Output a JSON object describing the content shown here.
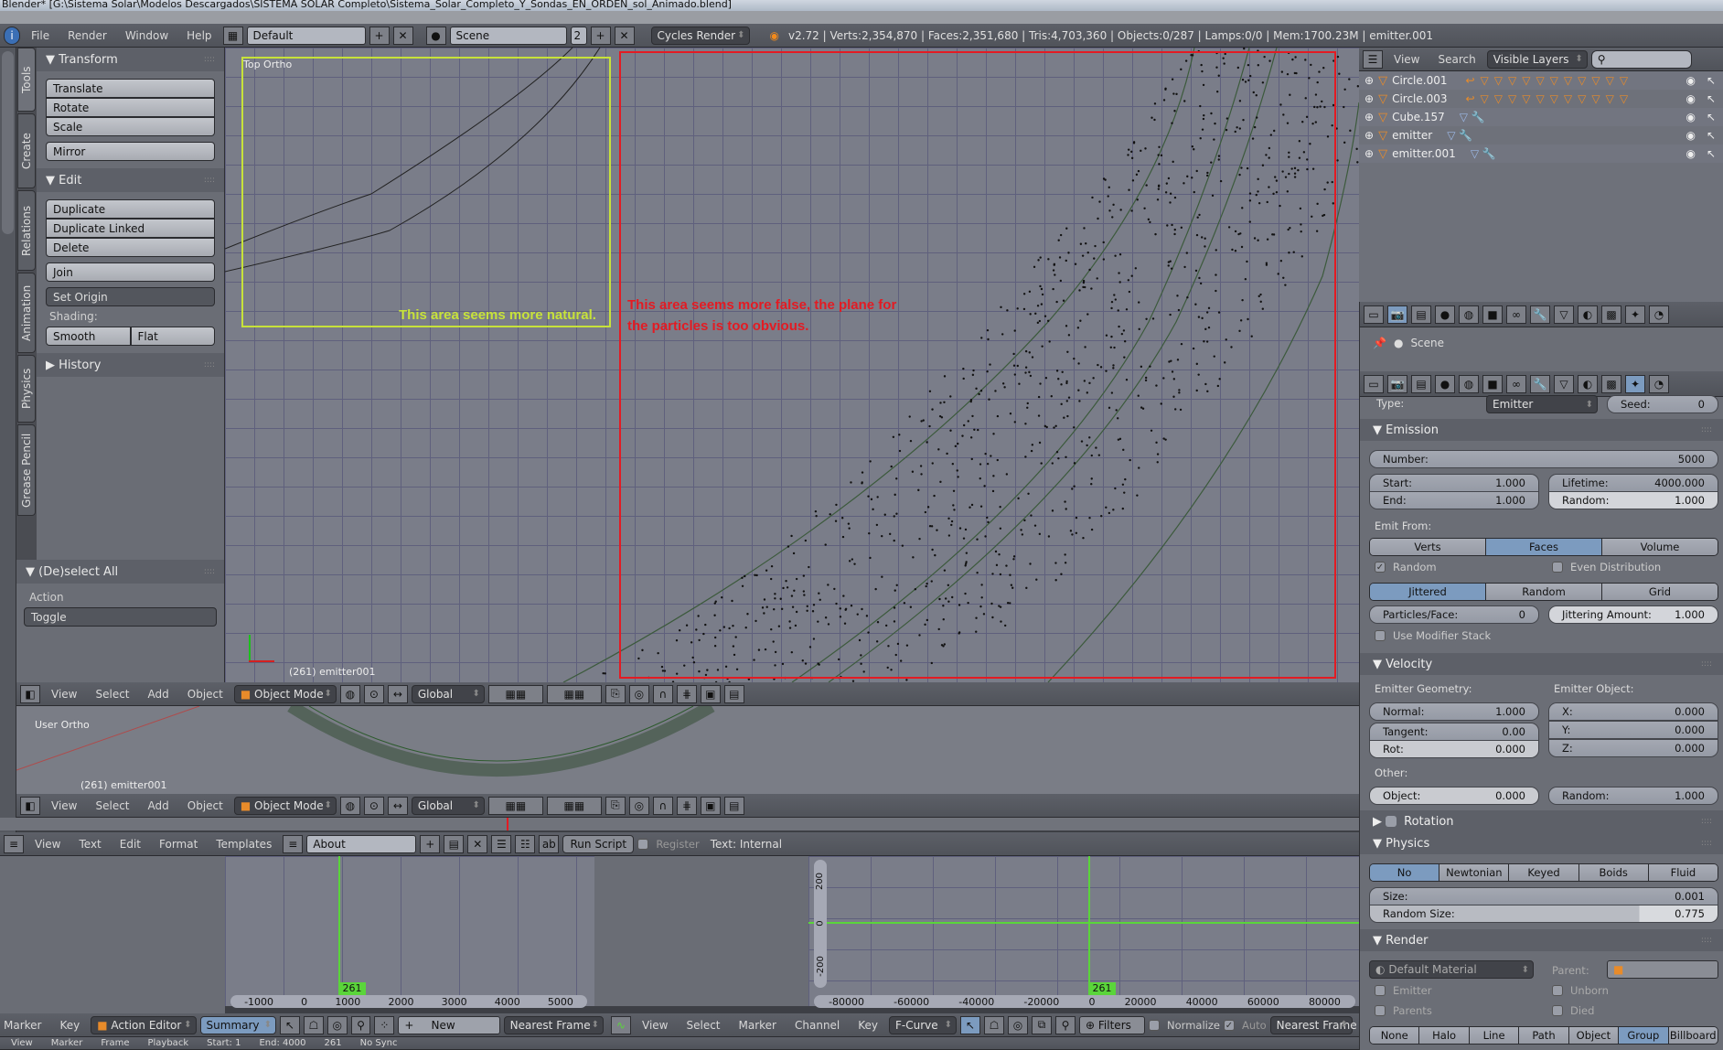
{
  "window": {
    "title": "Blender* [G:\\Sistema Solar\\Modelos Descargados\\SISTEMA SOLAR Completo\\Sistema_Solar_Completo_Y_Sondas_EN_ORDEN_sol_Animado.blend]"
  },
  "topbar": {
    "menus": [
      "File",
      "Render",
      "Window",
      "Help"
    ],
    "layout": "Default",
    "scene": "Scene",
    "scene_users": "2",
    "engine": "Cycles Render",
    "stats": "v2.72 | Verts:2,354,870 | Faces:2,351,680 | Tris:4,703,360 | Objects:0/287 | Lamps:0/0 | Mem:1700.23M | emitter.001"
  },
  "tool_tabs": [
    "Tools",
    "Create",
    "Relations",
    "Animation",
    "Physics",
    "Grease Pencil"
  ],
  "toolshelf": {
    "transform_title": "Transform",
    "transform_buttons": [
      "Translate",
      "Rotate",
      "Scale"
    ],
    "mirror": "Mirror",
    "edit_title": "Edit",
    "edit_buttons": [
      "Duplicate",
      "Duplicate Linked",
      "Delete"
    ],
    "join": "Join",
    "set_origin": "Set Origin",
    "shading_label": "Shading:",
    "smooth": "Smooth",
    "flat": "Flat",
    "history_title": "History",
    "operator_title": "(De)select All",
    "action_label": "Action",
    "action_value": "Toggle"
  },
  "viewport": {
    "view_name": "Top Ortho",
    "object_info": "(261) emitter001",
    "annotation_green": "This area seems more natural.",
    "annotation_red": "This area seems more false, the plane for the particles is too obvious.",
    "colors": {
      "green": "#c7e23a",
      "red": "#e31b23"
    }
  },
  "view_header": {
    "menus": [
      "View",
      "Select",
      "Add",
      "Object"
    ],
    "mode": "Object Mode",
    "orientation": "Global"
  },
  "viewport2": {
    "view_name": "User Ortho",
    "object_info": "(261) emitter001"
  },
  "text_editor": {
    "menus": [
      "View",
      "Text",
      "Edit",
      "Format",
      "Templates"
    ],
    "text_name": "About",
    "run_script": "Run Script",
    "register": "Register",
    "text_source": "Text: Internal"
  },
  "dopesheet": {
    "frame": "261",
    "ticks": [
      "-1000",
      "0",
      "1000",
      "2000",
      "3000",
      "4000",
      "5000"
    ],
    "menus": [
      "Marker",
      "Key"
    ],
    "mode": "Action Editor",
    "summary": "Summary",
    "new": "New",
    "snap": "Nearest Frame"
  },
  "graph": {
    "frame": "261",
    "xticks": [
      "-80000",
      "-60000",
      "-40000",
      "-20000",
      "0",
      "20000",
      "40000",
      "60000",
      "80000"
    ],
    "yticks": [
      "200",
      "0",
      "-200"
    ],
    "menus": [
      "View",
      "Select",
      "Marker",
      "Channel",
      "Key"
    ],
    "mode": "F-Curve",
    "filters": "Filters",
    "normalize": "Normalize",
    "auto": "Auto",
    "snap": "Nearest Frame"
  },
  "timeline": {
    "menus": [
      "View",
      "Marker",
      "Frame",
      "Playback"
    ],
    "start_label": "Start:",
    "start": "1",
    "end_label": "End:",
    "end": "4000",
    "current": "261",
    "sync": "No Sync"
  },
  "outliner": {
    "menus": [
      "View",
      "Search"
    ],
    "filter": "Visible Layers",
    "search_placeholder": "",
    "items": [
      "Circle.001",
      "Circle.003",
      "Cube.157",
      "emitter",
      "emitter.001"
    ]
  },
  "properties": {
    "pin_context": "Scene",
    "type_label": "Type:",
    "type": "Emitter",
    "seed_label": "Seed:",
    "seed": "0",
    "emission": {
      "title": "Emission",
      "number_label": "Number:",
      "number": "5000",
      "start_label": "Start:",
      "start": "1.000",
      "end_label": "End:",
      "end": "1.000",
      "lifetime_label": "Lifetime:",
      "lifetime": "4000.000",
      "random_label": "Random:",
      "random": "1.000",
      "emit_from_label": "Emit From:",
      "emit_from": [
        "Verts",
        "Faces",
        "Volume"
      ],
      "random_check": "Random",
      "even_dist": "Even Distribution",
      "dist": [
        "Jittered",
        "Random",
        "Grid"
      ],
      "ppf_label": "Particles/Face:",
      "ppf": "0",
      "jitter_label": "Jittering Amount:",
      "jitter": "1.000",
      "modifier_stack": "Use Modifier Stack"
    },
    "velocity": {
      "title": "Velocity",
      "geom_label": "Emitter Geometry:",
      "obj_label": "Emitter Object:",
      "normal_label": "Normal:",
      "normal": "1.000",
      "tangent_label": "Tangent:",
      "tangent": "0.00",
      "rot_label": "Rot:",
      "rot": "0.000",
      "x_label": "X:",
      "x": "0.000",
      "y_label": "Y:",
      "y": "0.000",
      "z_label": "Z:",
      "z": "0.000",
      "other_label": "Other:",
      "object_label": "Object:",
      "object": "0.000",
      "random_label": "Random:",
      "random": "1.000"
    },
    "rotation_title": "Rotation",
    "physics": {
      "title": "Physics",
      "types": [
        "No",
        "Newtonian",
        "Keyed",
        "Boids",
        "Fluid"
      ],
      "size_label": "Size:",
      "size": "0.001",
      "rsize_label": "Random Size:",
      "rsize": "0.775"
    },
    "render": {
      "title": "Render",
      "material": "Default Material",
      "parent_label": "Parent:",
      "checks": [
        "Emitter",
        "Unborn",
        "Parents",
        "Died"
      ],
      "types": [
        "None",
        "Halo",
        "Line",
        "Path",
        "Object",
        "Group",
        "Billboard"
      ]
    }
  }
}
